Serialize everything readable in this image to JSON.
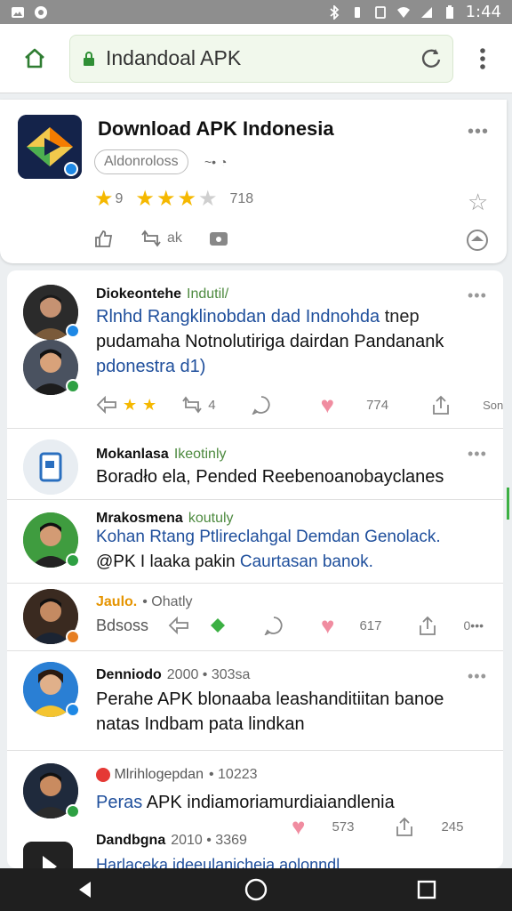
{
  "status_bar": {
    "time": "1:44"
  },
  "browser": {
    "url": "Indandoal APK"
  },
  "hero": {
    "title": "Download APK Indonesia",
    "pill": "Aldonroloss",
    "meta": "~• ◔",
    "rating_text_a": "9",
    "rating_text_b": "718",
    "action_count": "ak",
    "more": "•••"
  },
  "posts": [
    {
      "author": "Diokeontehe",
      "meta": "Indutil/",
      "text_line1": "Rlnhd Rangklinobdan dad Indnohda",
      "text_line1_end": "tnep",
      "text_line2": "pudamaha Notnolutiriga dairdan Pandanank",
      "text_line3": "pdonestra d1)",
      "actions": {
        "comment_count": "4",
        "heart_count": "774",
        "share_label": "Sonn"
      }
    },
    {
      "author": "Mokanlasa",
      "meta": "Ikeotinly",
      "text_line1": "Boradło ela, Pended Reebenoanobayclanes"
    },
    {
      "author": "Mrakosmena",
      "meta": "koutuly",
      "text_line1": "Kohan Rtang Ptlireclahgal Demdan Genolack.",
      "text_line2_a": "@PK I laaka pakin",
      "text_line2_b": "Caurtasan banok."
    },
    {
      "author": "Jaulo.",
      "meta": "• Ohatly",
      "text_line1": "Bdsoss",
      "actions": {
        "heart_count": "617",
        "more_label": "0•••"
      }
    },
    {
      "author": "Denniodo",
      "meta": "2000 • 303sa",
      "text_line1": "Perahe APK blonaaba leashanditiitan banoe",
      "text_line2": "natas Indbam pata lindkan"
    },
    {
      "author": "Mlrihlogepdan",
      "meta": "• 10223",
      "text_line1_a": "Peras",
      "text_line1_b": "APK indiamoriamurdiaiandlenia",
      "actions": {
        "heart_count": "573",
        "share_count": "245"
      }
    },
    {
      "author": "Dandbgna",
      "meta": "2010 • 3369",
      "text_line1": "Harlaceka ideeulanicheia aolonndl"
    }
  ],
  "colors": {
    "status_bar": "#8e8e8e",
    "nav_bar": "#1f1f1f",
    "link_blue": "#1f4f9c",
    "verified_green": "#2ea043",
    "star_yellow": "#f5b800",
    "heart_pink": "#f08ca0"
  }
}
